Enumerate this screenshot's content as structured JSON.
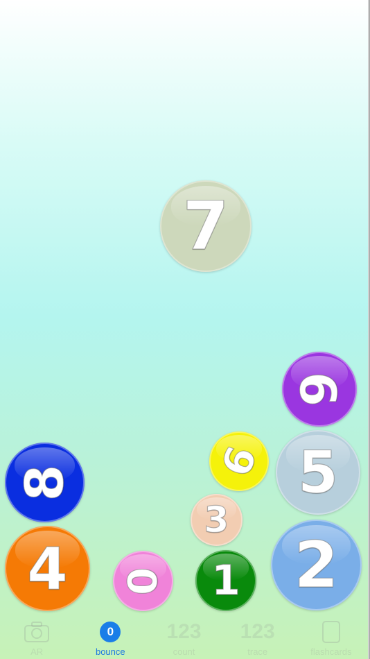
{
  "balls": [
    {
      "label": "7",
      "color": "#cdd8bb"
    },
    {
      "label": "9",
      "color": "#9a36e0"
    },
    {
      "label": "8",
      "color": "#0a2ee0"
    },
    {
      "label": "6",
      "color": "#f5f20a"
    },
    {
      "label": "5",
      "color": "#b7cfdc"
    },
    {
      "label": "3",
      "color": "#f2cdb2"
    },
    {
      "label": "4",
      "color": "#f57a05"
    },
    {
      "label": "0",
      "color": "#f083d9"
    },
    {
      "label": "1",
      "color": "#098a0c"
    },
    {
      "label": "2",
      "color": "#7aaee8"
    }
  ],
  "tabbar": {
    "tabs": [
      {
        "label": "AR",
        "icon": "camera-icon"
      },
      {
        "label": "bounce",
        "badge": "0",
        "icon": "badge"
      },
      {
        "label": "count",
        "icon_text": "123"
      },
      {
        "label": "trace",
        "icon_text": "123"
      },
      {
        "label": "flashcards",
        "icon": "card-icon"
      }
    ],
    "active_color": "#1f7ae0"
  }
}
